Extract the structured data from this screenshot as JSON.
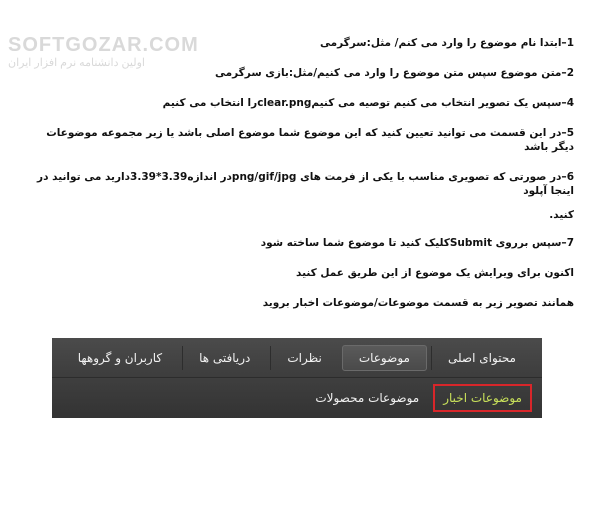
{
  "watermark": {
    "line1": "SOFTGOZAR.COM",
    "line2": "اولین دانشنامه نرم افزار ایران"
  },
  "steps": [
    "1–ابتدا نام موضوع را وارد می کنم/ مثل:سرگرمی",
    "2–متن موضوع سپس متن موضوع را وارد می کنیم/مثل:بازی سرگرمی",
    "4–سپس یک تصویر انتخاب می کنیم توصیه می کنیمclear.pngرا انتخاب می کنیم",
    "5–در این قسمت می توانید تعیین کنید که این موضوع شما موضوع اصلی باشد یا زیر مجموعه موضوعات دیگر باشد"
  ],
  "step6": {
    "line1": "6–در صورتی که تصویری مناسب با یکی از فرمت های png/gif/jpgدر اندازه3.39*3.39داريد می توانید در اینجا آپلود",
    "line2": "کنید."
  },
  "step7": "7–سپس برروی Submitکلیک کنید تا موضوع شما ساخته شود",
  "note1": "اکنون برای ویرایش یک موضوع از این طریق عمل کنید",
  "note2": "همانند تصویر زیر به قسمت موضوعات/موضوعات اخبار بروید",
  "navbar": {
    "tabs": [
      "محتوای اصلی",
      "موضوعات",
      "نظرات",
      "دریافتی ها",
      "کاربران و گروهها"
    ],
    "active_tab": "موضوعات",
    "subnav": [
      "موضوعات اخبار",
      "موضوعات محصولات"
    ],
    "active_sub": "موضوعات اخبار",
    "colors": {
      "bar": "#3a3a3a",
      "active_sub_text": "#c8e05a",
      "highlight_border": "#d8262a"
    }
  }
}
